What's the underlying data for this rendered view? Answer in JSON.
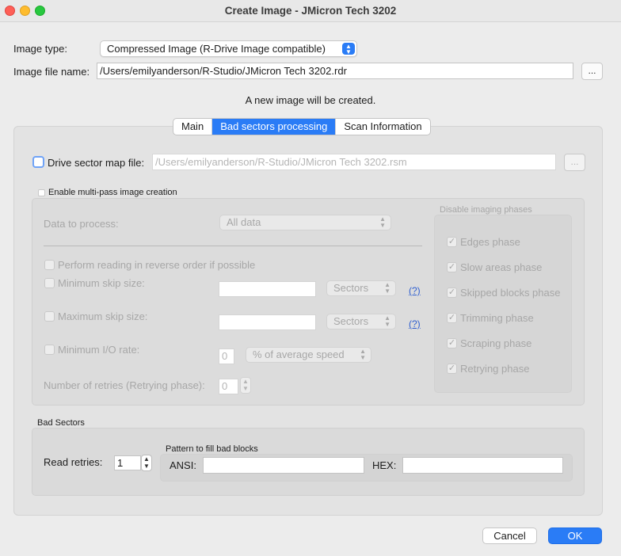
{
  "window": {
    "title": "Create Image - JMicron Tech 3202"
  },
  "image_type": {
    "label": "Image type:",
    "value": "Compressed Image (R-Drive Image compatible)"
  },
  "image_file": {
    "label": "Image file name:",
    "value": "/Users/emilyanderson/R-Studio/JMicron Tech 3202.rdr",
    "browse_label": "..."
  },
  "status_message": "A new image will be created.",
  "tabs": [
    {
      "label": "Main",
      "active": false
    },
    {
      "label": "Bad sectors processing",
      "active": true
    },
    {
      "label": "Scan Information",
      "active": false
    }
  ],
  "sector_map": {
    "label": "Drive sector map file:",
    "placeholder": "/Users/emilyanderson/R-Studio/JMicron Tech 3202.rsm",
    "browse_label": "...",
    "checked": false
  },
  "multipass": {
    "label": "Enable multi-pass image creation",
    "checked": false,
    "data_to_process": {
      "label": "Data to process:",
      "value": "All data"
    },
    "reverse": {
      "label": "Perform reading in reverse order if possible"
    },
    "min_skip": {
      "label": "Minimum skip size:",
      "value": "",
      "unit": "Sectors",
      "help": "(?)"
    },
    "max_skip": {
      "label": "Maximum skip size:",
      "value": "",
      "unit": "Sectors",
      "help": "(?)"
    },
    "min_io": {
      "label": "Minimum I/O rate:",
      "value": "0",
      "unit": "% of average speed"
    },
    "retries": {
      "label": "Number of retries (Retrying phase):",
      "value": "0"
    }
  },
  "phases": {
    "title": "Disable imaging phases",
    "items": [
      {
        "label": "Edges phase",
        "checked": true
      },
      {
        "label": "Slow areas phase",
        "checked": true
      },
      {
        "label": "Skipped blocks phase",
        "checked": true
      },
      {
        "label": "Trimming phase",
        "checked": true
      },
      {
        "label": "Scraping phase",
        "checked": true
      },
      {
        "label": "Retrying phase",
        "checked": true
      }
    ]
  },
  "bad_sectors": {
    "title": "Bad Sectors",
    "read_retries_label": "Read retries:",
    "read_retries_value": "1",
    "pattern_title": "Pattern to fill bad blocks",
    "ansi_label": "ANSI:",
    "ansi_value": "",
    "hex_label": "HEX:",
    "hex_value": ""
  },
  "buttons": {
    "cancel": "Cancel",
    "ok": "OK"
  },
  "colors": {
    "accent": "#2a7cf6",
    "disabled_text": "#a7a7a7",
    "help_link": "#2f5fd0"
  }
}
